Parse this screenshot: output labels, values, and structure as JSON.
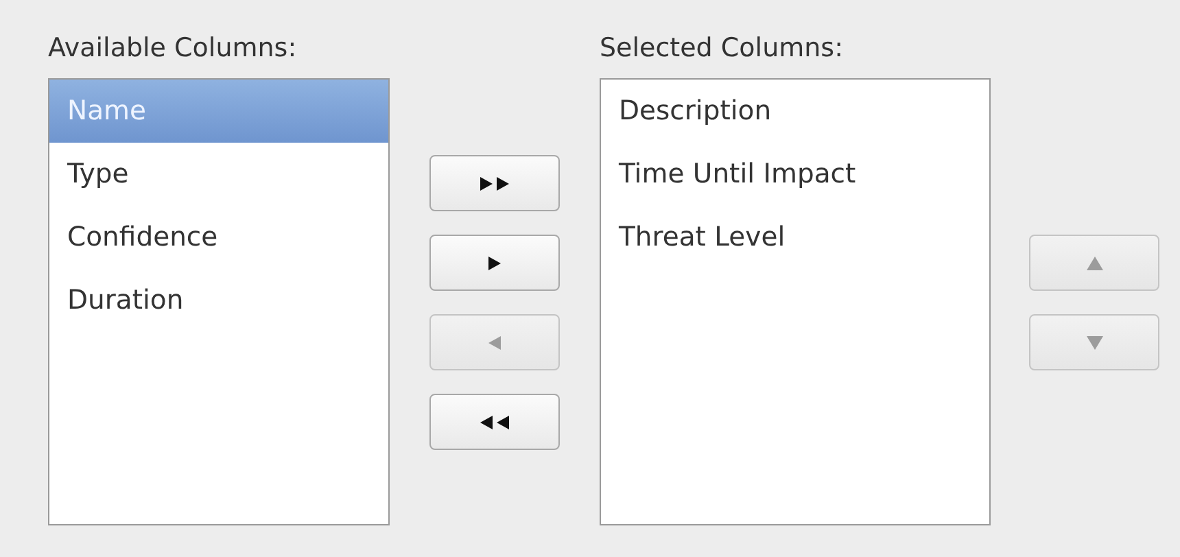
{
  "available": {
    "label": "Available Columns:",
    "items": [
      {
        "text": "Name",
        "selected": true
      },
      {
        "text": "Type",
        "selected": false
      },
      {
        "text": "Confidence",
        "selected": false
      },
      {
        "text": "Duration",
        "selected": false
      }
    ]
  },
  "move_buttons": [
    {
      "kind": "add_all",
      "disabled": false
    },
    {
      "kind": "add",
      "disabled": false
    },
    {
      "kind": "remove",
      "disabled": true
    },
    {
      "kind": "remove_all",
      "disabled": false
    }
  ],
  "selected": {
    "label": "Selected Columns:",
    "items": [
      {
        "text": "Description",
        "selected": false
      },
      {
        "text": "Time Until Impact",
        "selected": false
      },
      {
        "text": "Threat Level",
        "selected": false
      }
    ]
  },
  "order_buttons": [
    {
      "kind": "up",
      "disabled": true
    },
    {
      "kind": "down",
      "disabled": true
    }
  ]
}
